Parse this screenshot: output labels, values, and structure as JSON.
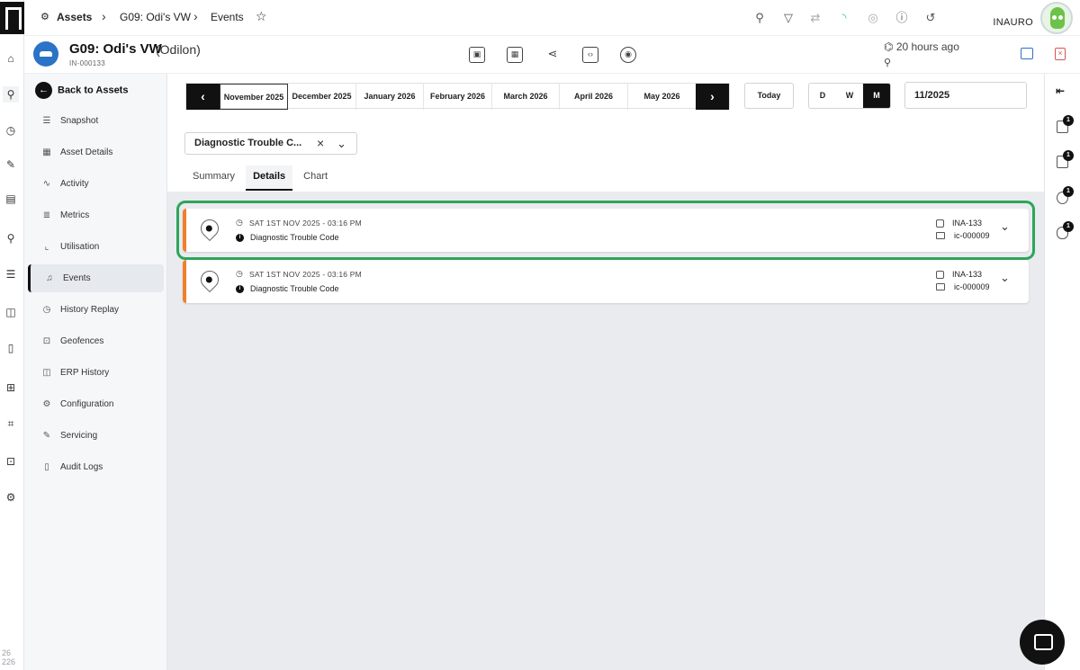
{
  "breadcrumb": {
    "assets_label": "Assets",
    "asset_label": "G09: Odi's VW",
    "page_label": "Events"
  },
  "user": {
    "name": "INAURO"
  },
  "asset": {
    "title": "G09: Odi's VW",
    "subtitle": "(Odilon)",
    "id": "IN-000133",
    "last_seen": "20 hours ago"
  },
  "sidenav": {
    "back_label": "Back to Assets",
    "items": [
      {
        "label": "Snapshot"
      },
      {
        "label": "Asset Details"
      },
      {
        "label": "Activity"
      },
      {
        "label": "Metrics"
      },
      {
        "label": "Utilisation"
      },
      {
        "label": "Events"
      },
      {
        "label": "History Replay"
      },
      {
        "label": "Geofences"
      },
      {
        "label": "ERP History"
      },
      {
        "label": "Configuration"
      },
      {
        "label": "Servicing"
      },
      {
        "label": "Audit Logs"
      }
    ]
  },
  "calendar": {
    "months": [
      "November 2025",
      "December 2025",
      "January 2026",
      "February 2026",
      "March 2026",
      "April 2026",
      "May 2026"
    ],
    "today_label": "Today",
    "views": [
      "D",
      "W",
      "M"
    ],
    "selected_view": "M",
    "date_value": "11/2025"
  },
  "filter": {
    "value": "Diagnostic Trouble C..."
  },
  "tabs": [
    {
      "label": "Summary"
    },
    {
      "label": "Details"
    },
    {
      "label": "Chart"
    }
  ],
  "events": [
    {
      "time": "SAT 1ST NOV 2025 - 03:16 PM",
      "type": "Diagnostic Trouble Code",
      "device": "INA-133",
      "code": "ic-000009"
    },
    {
      "time": "SAT 1ST NOV 2025 - 03:16 PM",
      "type": "Diagnostic Trouble Code",
      "device": "INA-133",
      "code": "ic-000009"
    }
  ],
  "right_rail": {
    "badges": [
      "1",
      "1",
      "1",
      "1"
    ]
  },
  "footer": {
    "version": "26 226"
  },
  "colors": {
    "accent": "#111111",
    "event_stripe": "#f07f2c",
    "highlight": "#2ea55a",
    "archive": "#2b73c7",
    "delete": "#e05252"
  }
}
